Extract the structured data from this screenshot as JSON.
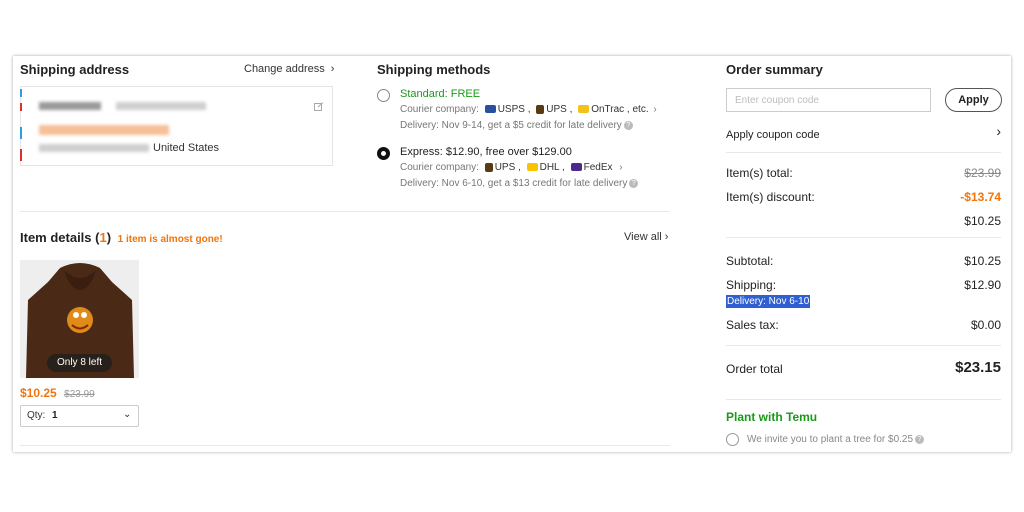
{
  "shipping_address": {
    "title": "Shipping address",
    "change_label": "Change address",
    "country": "United States"
  },
  "shipping_methods": {
    "title": "Shipping methods",
    "standard": {
      "label": "Standard: FREE",
      "courier_prefix": "Courier company:",
      "couriers": [
        "USPS ,",
        "UPS ,",
        "OnTrac , etc."
      ],
      "delivery": "Delivery: Nov 9-14, get a $5 credit for late delivery"
    },
    "express": {
      "label": "Express: $12.90, free over $129.00",
      "courier_prefix": "Courier company:",
      "couriers": [
        "UPS ,",
        "DHL ,",
        "FedEx"
      ],
      "delivery": "Delivery: Nov 6-10, get a $13 credit for late delivery"
    }
  },
  "item_details": {
    "title": "Item details (",
    "count": "1",
    "title_close": ")",
    "alert": "1 item is almost gone!",
    "view_all": "View all",
    "item": {
      "stock_badge": "Only 8 left",
      "price": "$10.25",
      "original_price": "$23.99",
      "qty_label": "Qty:",
      "qty_value": "1"
    }
  },
  "order_summary": {
    "title": "Order summary",
    "coupon_placeholder": "Enter coupon code",
    "apply_label": "Apply",
    "apply_coupon_label": "Apply coupon code",
    "items_total_label": "Item(s) total:",
    "items_total_value": "$23.99",
    "items_discount_label": "Item(s) discount:",
    "items_discount_value": "-$13.74",
    "after_discount_value": "$10.25",
    "subtotal_label": "Subtotal:",
    "subtotal_value": "$10.25",
    "shipping_label": "Shipping:",
    "shipping_value": "$12.90",
    "delivery_note": "Delivery: Nov 6-10",
    "sales_tax_label": "Sales tax:",
    "sales_tax_value": "$0.00",
    "order_total_label": "Order total",
    "order_total_value": "$23.15"
  },
  "plant": {
    "title": "Plant with Temu",
    "invite": "We invite you to plant a tree for $0.25"
  },
  "colors": {
    "accent_orange": "#f0750f",
    "green": "#1a9a1a",
    "highlight_blue": "#2f5fd0"
  }
}
